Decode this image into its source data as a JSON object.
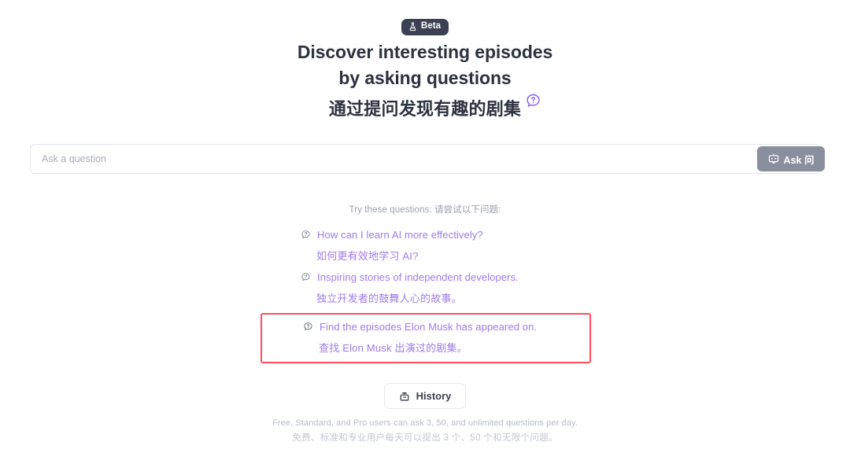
{
  "badge": {
    "label": "Beta",
    "icon": "flask-icon",
    "bg_color": "#3b4152",
    "text_color": "#ffffff"
  },
  "heading": {
    "line1": "Discover interesting episodes",
    "line2": "by asking questions",
    "line_cn": "通过提问发现有趣的剧集",
    "annotation_icon": "question-bubble-icon",
    "accent_color": "#8b5cf6",
    "text_color": "#2d3240"
  },
  "search": {
    "value": "",
    "placeholder": "Ask a question",
    "button_label": "Ask 问",
    "button_icon": "message-bubble-icon",
    "button_color": "#8a8f9e"
  },
  "suggestions": {
    "heading": "Try these questions: 请尝试以下问题:",
    "link_color": "#9f7aea",
    "highlight_color": "#ff4d5e",
    "items": [
      {
        "icon": "question-bubble-icon",
        "en": "How can I learn AI more effectively?",
        "cn": "如何更有效地学习 AI?",
        "highlighted": false
      },
      {
        "icon": "question-bubble-icon",
        "en": "Inspiring stories of independent developers.",
        "cn": "独立开发者的鼓舞人心的故事。",
        "highlighted": false
      },
      {
        "icon": "question-bubble-icon",
        "en": "Find the episodes Elon Musk has appeared on.",
        "cn": "查找 Elon Musk 出演过的剧集。",
        "highlighted": true
      }
    ]
  },
  "history": {
    "label": "History",
    "icon": "archive-box-icon"
  },
  "footer": {
    "line_en": "Free, Standard, and Pro users can ask 3, 50, and unlimited questions per day.",
    "line_cn": "免费、标准和专业用户每天可以提出 3 个、50 个和无限个问题。"
  }
}
